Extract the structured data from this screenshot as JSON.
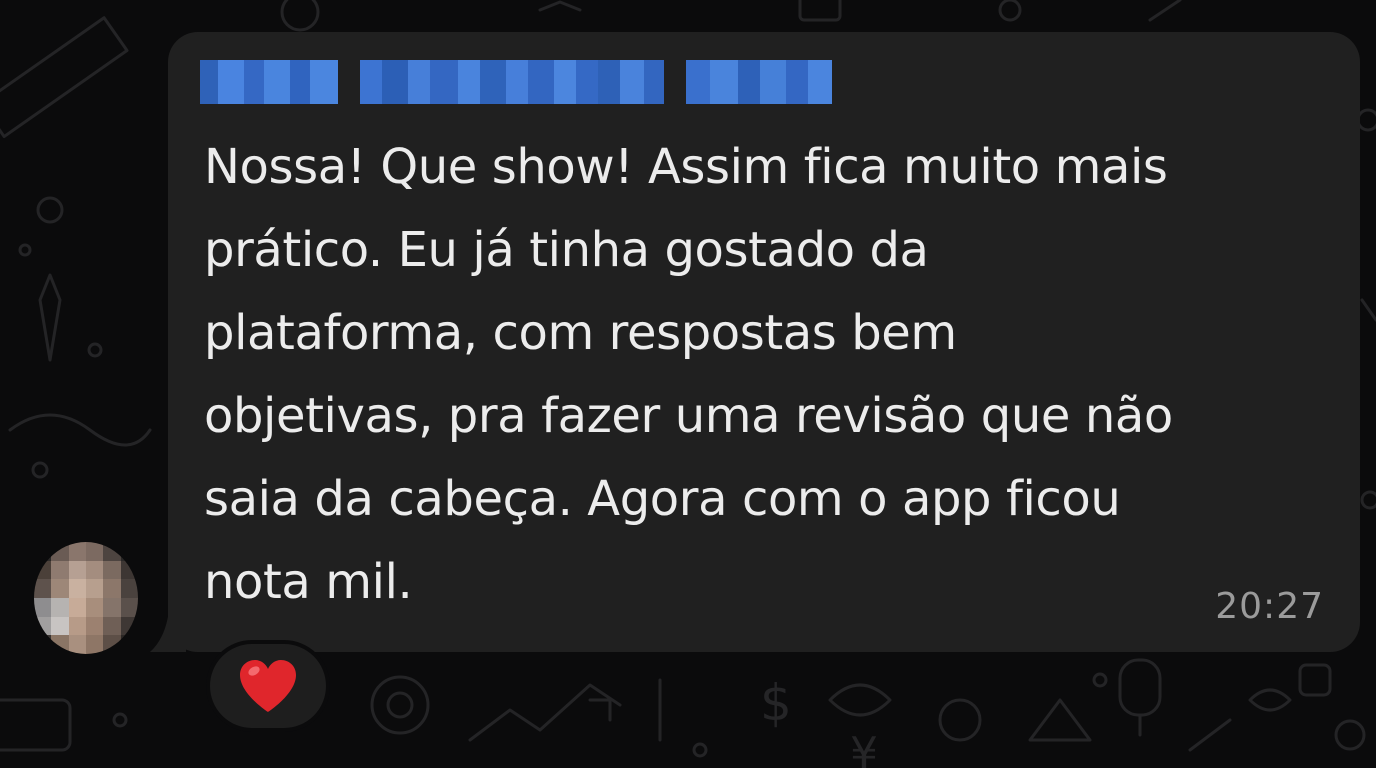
{
  "message": {
    "lines": [
      "Nossa! Que show! Assim fica muito mais",
      "prático. Eu já tinha gostado da",
      "plataforma, com respostas bem",
      "objetivas, pra fazer uma revisão que não",
      "saia da cabeça. Agora com o app ficou",
      "nota mil."
    ],
    "time": "20:27",
    "reaction": "heart-icon"
  },
  "colors": {
    "background": "#0b0b0c",
    "bubble": "#202020",
    "text": "#ececec",
    "timestamp": "#9b9b9b",
    "sender_name_blur": "#3a6fd0",
    "reaction_heart": "#e0262c"
  }
}
